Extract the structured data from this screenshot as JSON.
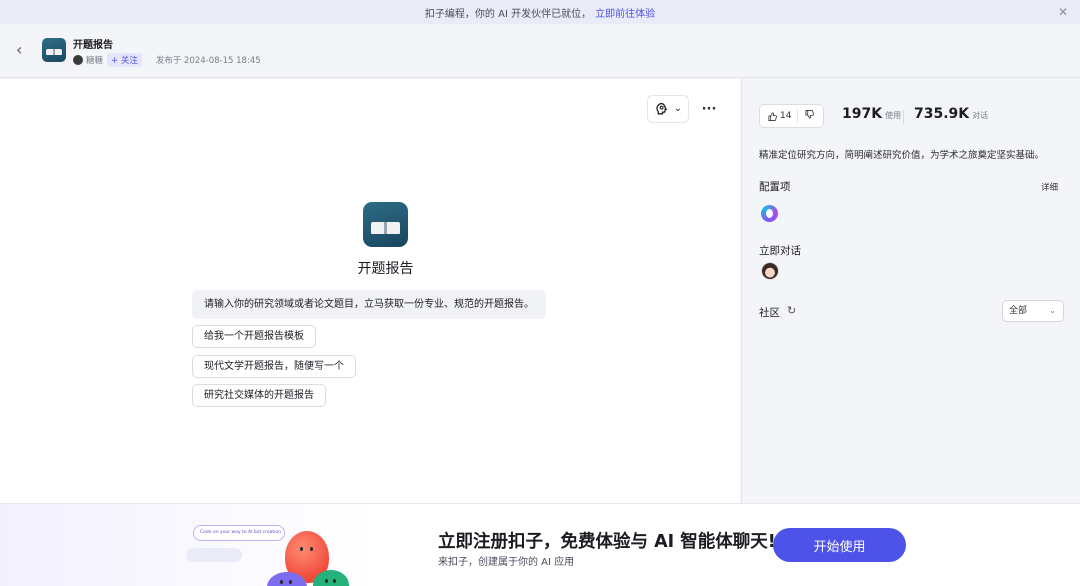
{
  "banner": {
    "text": "扣子编程，你的 AI 开发伙伴已就位，",
    "link": "立即前往体验",
    "close_glyph": "✕"
  },
  "header": {
    "back_glyph": "‹",
    "bot_name": "开题报告",
    "author": "糖糖",
    "follow_label": "+ 关注",
    "published": "发布于 2024-08-15 18:45"
  },
  "main": {
    "model_icon": "brain-icon",
    "more_glyph": "···",
    "chevron_glyph": "⌄",
    "bot_title": "开题报告",
    "opening_message": "请输入你的研究领域或者论文题目，立马获取一份专业、规范的开题报告。",
    "suggestions": [
      "给我一个开题报告模板",
      "现代文学开题报告，随便写一个",
      "研究社交媒体的开题报告"
    ]
  },
  "sidebar": {
    "likes": "14",
    "usage_count": "197K",
    "usage_label": "使用",
    "chat_count": "735.9K",
    "chat_label": "对话",
    "description": "精准定位研究方向，简明阐述研究价值，为学术之旅奠定坚实基础。",
    "config_label": "配置项",
    "details_label": "详细",
    "chat_now_label": "立即对话",
    "community_label": "社区",
    "refresh_glyph": "↻",
    "filter_value": "全部",
    "filter_chevron": "⌄"
  },
  "footer": {
    "bubble_text": "Code on your way to AI bot creation",
    "title": "立即注册扣子，免费体验与 AI 智能体聊天!",
    "subtitle": "来扣子，创建属于你的 AI 应用",
    "button_label": "开始使用"
  },
  "colors": {
    "accent": "#4d53e8",
    "banner_bg": "#e9ebf7",
    "page_bg": "#f4f5f9"
  }
}
